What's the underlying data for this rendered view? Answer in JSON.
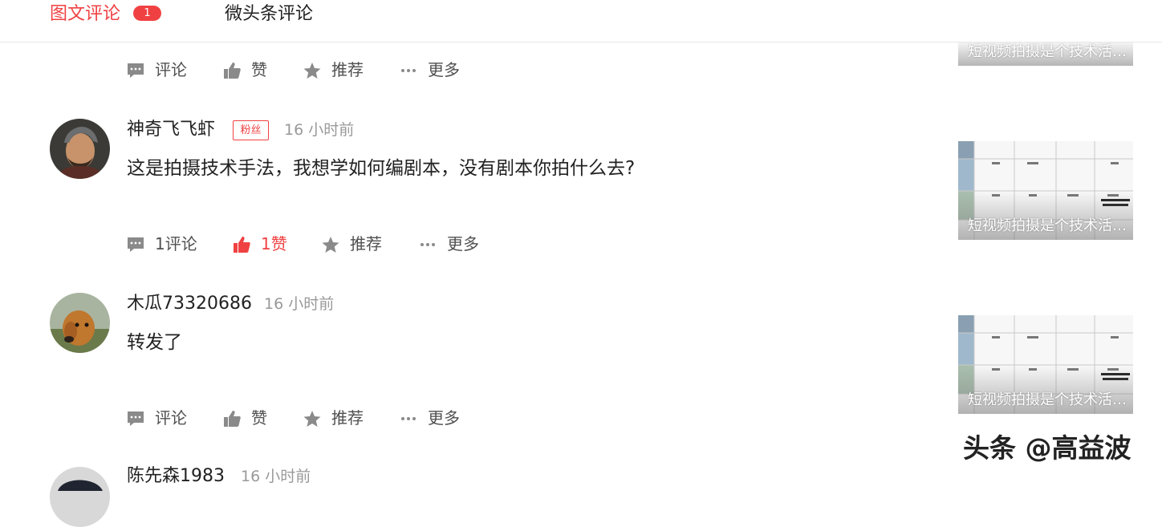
{
  "tabs": {
    "active_label": "图文评论",
    "active_badge": "1",
    "second_label": "微头条评论"
  },
  "comments": [
    {
      "actions": {
        "comment": "评论",
        "like": "赞",
        "recommend": "推荐",
        "more": "更多"
      }
    },
    {
      "username": "神奇飞飞虾",
      "badge": "粉丝",
      "time": "16 小时前",
      "text": "这是拍摄技术手法，我想学如何编剧本，没有剧本你拍什么去?",
      "liked": true,
      "actions": {
        "comment": "1评论",
        "like": "1赞",
        "recommend": "推荐",
        "more": "更多"
      }
    },
    {
      "username": "木瓜73320686",
      "time": "16 小时前",
      "text": "转发了",
      "liked": false,
      "actions": {
        "comment": "评论",
        "like": "赞",
        "recommend": "推荐",
        "more": "更多"
      }
    },
    {
      "username": "陈先森1983",
      "time": "16 小时前"
    }
  ],
  "article_thumbs": [
    {
      "caption": "短视频拍摄是个技术活，看完这篇你就懂了"
    },
    {
      "caption": "短视频拍摄是个技术活，看完这篇你就懂了"
    },
    {
      "caption": "短视频拍摄是个技术活，看完这篇你就懂了"
    }
  ],
  "watermark": "头条 @高益波",
  "colors": {
    "accent": "#f04142",
    "text": "#222222",
    "muted": "#999999",
    "icon": "#505050"
  },
  "icons": [
    "comment-icon",
    "thumbs-up-icon",
    "star-icon",
    "more-dots-icon"
  ]
}
